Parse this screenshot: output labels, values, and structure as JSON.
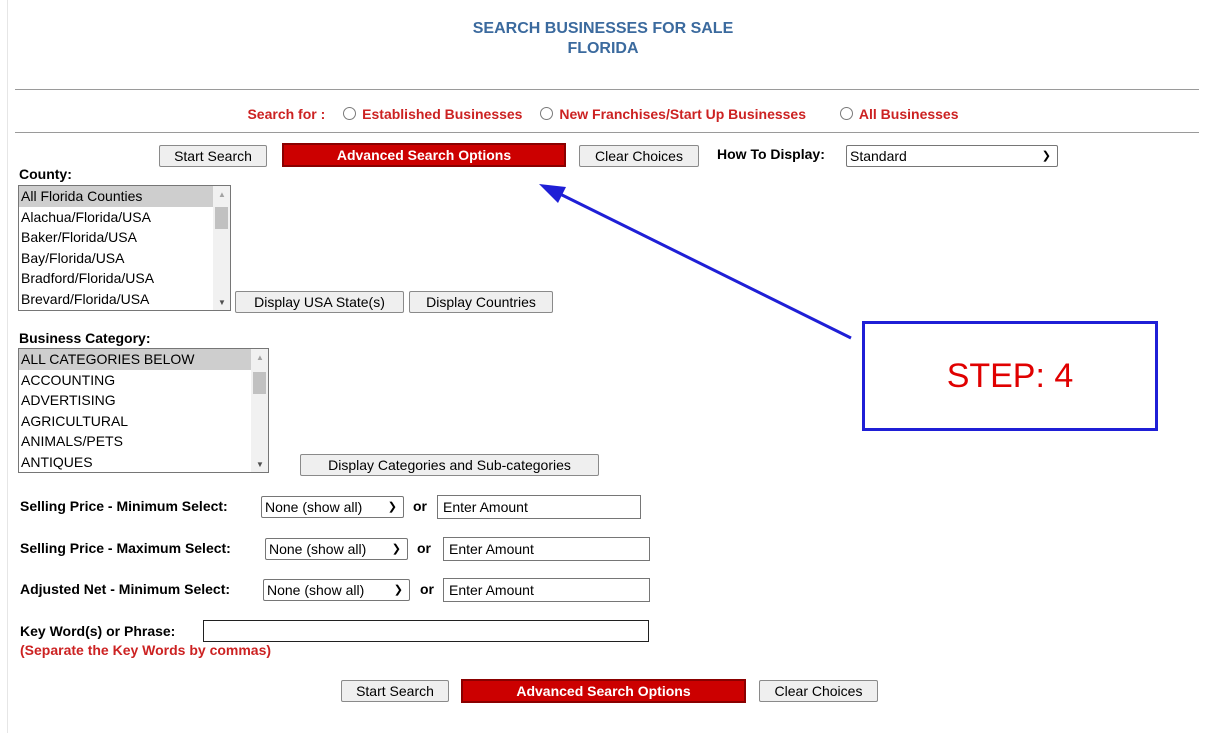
{
  "header": {
    "title_line1": "SEARCH BUSINESSES FOR SALE",
    "title_line2": "FLORIDA"
  },
  "search_for": {
    "label": "Search for :",
    "options": [
      "Established Businesses",
      "New Franchises/Start Up Businesses",
      "All Businesses"
    ]
  },
  "toolbar": {
    "start_search": "Start Search",
    "advanced": "Advanced Search Options",
    "clear": "Clear Choices",
    "display_label": "How To Display:",
    "display_value": "Standard"
  },
  "county": {
    "label": "County:",
    "items": [
      "All Florida Counties",
      "Alachua/Florida/USA",
      "Baker/Florida/USA",
      "Bay/Florida/USA",
      "Bradford/Florida/USA",
      "Brevard/Florida/USA"
    ],
    "btn_states": "Display USA State(s)",
    "btn_countries": "Display Countries"
  },
  "category": {
    "label": "Business Category:",
    "items": [
      "ALL CATEGORIES BELOW",
      "ACCOUNTING",
      "ADVERTISING",
      "AGRICULTURAL",
      "ANIMALS/PETS",
      "ANTIQUES"
    ],
    "btn_display": "Display Categories and Sub-categories"
  },
  "price_filters": [
    {
      "label": "Selling Price - Minimum Select:",
      "select": "None (show all)",
      "or": "or",
      "placeholder": "Enter Amount"
    },
    {
      "label": "Selling Price - Maximum Select:",
      "select": "None (show all)",
      "or": "or",
      "placeholder": "Enter Amount"
    },
    {
      "label": "Adjusted Net - Minimum Select:",
      "select": "None (show all)",
      "or": "or",
      "placeholder": "Enter Amount"
    }
  ],
  "keywords": {
    "label": "Key Word(s) or Phrase:",
    "note": "(Separate the Key Words by commas)",
    "value": ""
  },
  "bottom": {
    "start_search": "Start Search",
    "advanced": "Advanced Search Options",
    "clear": "Clear Choices"
  },
  "annotation": {
    "text": "STEP: 4",
    "color_text": "#e00000",
    "color_border": "#1f1fd6",
    "arrow_color": "#1f1fd6"
  },
  "colors": {
    "title": "#3b6a9e",
    "accent_red": "#cc0000",
    "label_red": "#cc2222"
  }
}
